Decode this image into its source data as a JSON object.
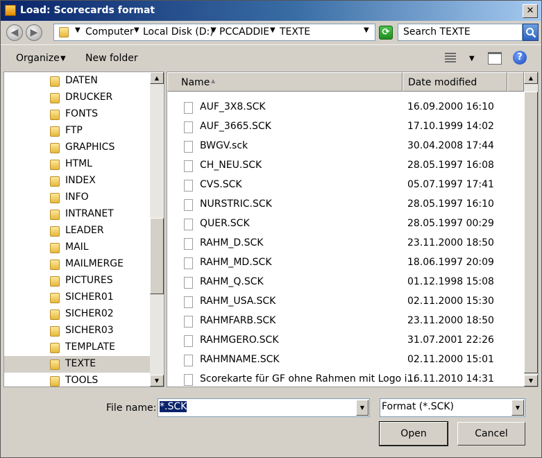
{
  "window": {
    "title": "Load: Scorecards format",
    "close_label": "✕"
  },
  "nav": {
    "back_glyph": "◀",
    "forward_glyph": "▶",
    "breadcrumb": [
      "Computer",
      "Local Disk (D:)",
      "PCCADDIE",
      "TEXTE"
    ],
    "refresh_glyph": "⟳"
  },
  "search": {
    "placeholder": "Search TEXTE"
  },
  "toolbar": {
    "organize_label": "Organize",
    "new_folder_label": "New folder",
    "help_label": "?"
  },
  "tree": {
    "items": [
      {
        "label": "DATEN"
      },
      {
        "label": "DRUCKER"
      },
      {
        "label": "FONTS"
      },
      {
        "label": "FTP"
      },
      {
        "label": "GRAPHICS"
      },
      {
        "label": "HTML"
      },
      {
        "label": "INDEX"
      },
      {
        "label": "INFO"
      },
      {
        "label": "INTRANET"
      },
      {
        "label": "LEADER"
      },
      {
        "label": "MAIL"
      },
      {
        "label": "MAILMERGE"
      },
      {
        "label": "PICTURES"
      },
      {
        "label": "SICHER01"
      },
      {
        "label": "SICHER02"
      },
      {
        "label": "SICHER03"
      },
      {
        "label": "TEMPLATE"
      },
      {
        "label": "TEXTE",
        "selected": true
      },
      {
        "label": "TOOLS"
      }
    ]
  },
  "files": {
    "columns": [
      "Name",
      "Date modified"
    ],
    "rows": [
      {
        "name": "AUF_3X8.SCK",
        "date": "16.09.2000 16:10"
      },
      {
        "name": "AUF_3665.SCK",
        "date": "17.10.1999 14:02"
      },
      {
        "name": "BWGV.sck",
        "date": "30.04.2008 17:44"
      },
      {
        "name": "CH_NEU.SCK",
        "date": "28.05.1997 16:08"
      },
      {
        "name": "CVS.SCK",
        "date": "05.07.1997 17:41"
      },
      {
        "name": "NURSTRIC.SCK",
        "date": "28.05.1997 16:10"
      },
      {
        "name": "QUER.SCK",
        "date": "28.05.1997 00:29"
      },
      {
        "name": "RAHM_D.SCK",
        "date": "23.11.2000 18:50"
      },
      {
        "name": "RAHM_MD.SCK",
        "date": "18.06.1997 20:09"
      },
      {
        "name": "RAHM_Q.SCK",
        "date": "01.12.1998 15:08"
      },
      {
        "name": "RAHM_USA.SCK",
        "date": "02.11.2000 15:30"
      },
      {
        "name": "RAHMFARB.SCK",
        "date": "23.11.2000 18:50"
      },
      {
        "name": "RAHMGERO.SCK",
        "date": "31.07.2001 22:26"
      },
      {
        "name": "RAHMNAME.SCK",
        "date": "02.11.2000 15:01"
      },
      {
        "name": "Scorekarte für GF ohne Rahmen mit Logo i...",
        "date": "16.11.2010 14:31"
      }
    ]
  },
  "bottom": {
    "file_name_label": "File name:",
    "file_name_value": "*.SCK",
    "format_value": "Format (*.SCK)",
    "open_label": "Open",
    "cancel_label": "Cancel"
  }
}
